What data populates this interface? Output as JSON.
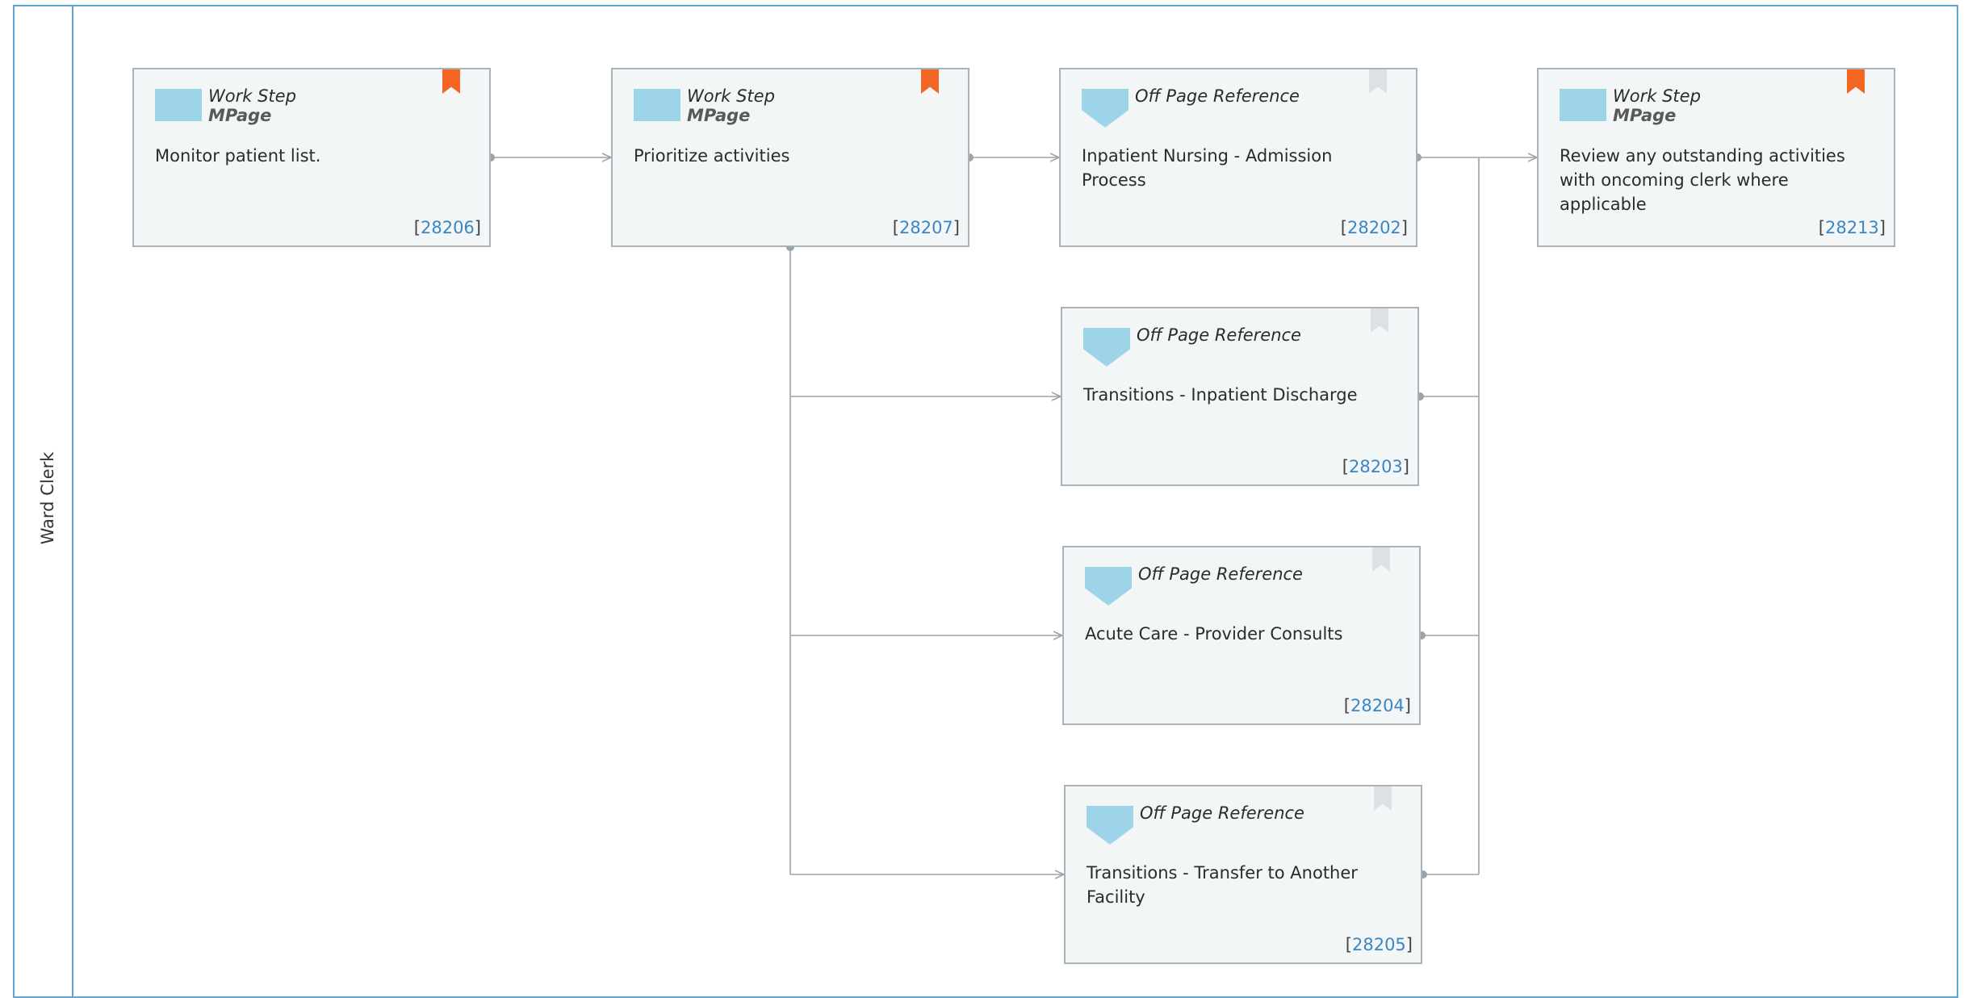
{
  "lane": {
    "label": "Ward Clerk"
  },
  "colors": {
    "lane_border": "#5aa7d6",
    "card_bg": "#f3f6f7",
    "card_border": "#a9b3ba",
    "icon": "#9dd4ea",
    "bookmark_active": "#f26522",
    "bookmark_inactive": "#dde1e3",
    "link": "#3a86c4",
    "connector": "#9ba3a8"
  },
  "cards": [
    {
      "id": "28206",
      "type": "work-step",
      "title": "Work Step",
      "subtitle": "MPage",
      "description": "Monitor patient list.",
      "bookmark": "orange-bookmark-icon"
    },
    {
      "id": "28207",
      "type": "work-step",
      "title": "Work Step",
      "subtitle": "MPage",
      "description": "Prioritize activities",
      "bookmark": "orange-bookmark-icon"
    },
    {
      "id": "28202",
      "type": "off-page",
      "title": "Off Page Reference",
      "subtitle": "",
      "description": "Inpatient Nursing -  Admission Process",
      "bookmark": "grey-bookmark-icon"
    },
    {
      "id": "28213",
      "type": "work-step",
      "title": "Work Step",
      "subtitle": "MPage",
      "description": "Review any outstanding activities with oncoming clerk where applicable",
      "bookmark": "orange-bookmark-icon"
    },
    {
      "id": "28203",
      "type": "off-page",
      "title": "Off Page Reference",
      "subtitle": "",
      "description": "Transitions -  Inpatient Discharge",
      "bookmark": "grey-bookmark-icon"
    },
    {
      "id": "28204",
      "type": "off-page",
      "title": "Off Page Reference",
      "subtitle": "",
      "description": "Acute Care - Provider Consults",
      "bookmark": "grey-bookmark-icon"
    },
    {
      "id": "28205",
      "type": "off-page",
      "title": "Off Page Reference",
      "subtitle": "",
      "description": "Transitions - Transfer to Another Facility",
      "bookmark": "grey-bookmark-icon"
    }
  ]
}
